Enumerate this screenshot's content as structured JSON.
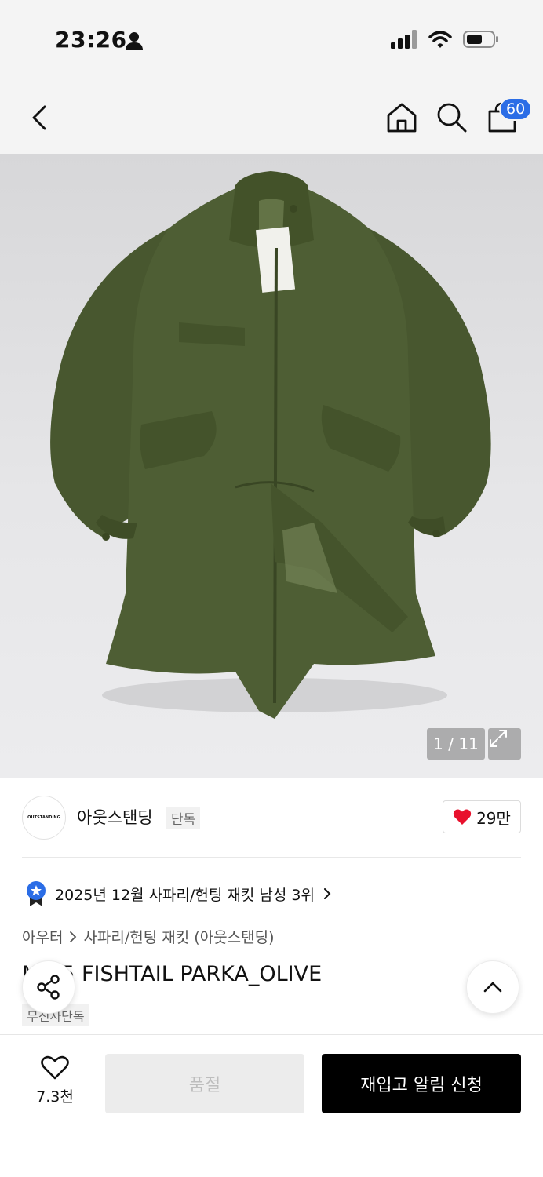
{
  "status_bar": {
    "time": "23:26"
  },
  "nav": {
    "cart_count": "60"
  },
  "gallery": {
    "counter": "1 / 11"
  },
  "brand": {
    "logo_text": "OUTSTANDING",
    "name": "아웃스탠딩",
    "tag": "단독",
    "likes": "29만"
  },
  "ranking": {
    "text": "2025년 12월 사파리/헌팅 재킷 남성 3위"
  },
  "breadcrumb": {
    "category": "아우터",
    "subcategory": "사파리/헌팅 재킷 (아웃스탠딩)"
  },
  "product": {
    "title": "M-65 FISHTAIL PARKA_OLIVE",
    "exclusive_tag": "무신사단독"
  },
  "bottom": {
    "wish_count": "7.3천",
    "soldout_label": "품절",
    "restock_label": "재입고 알림 신청"
  },
  "colors": {
    "accent": "#2b6de6",
    "heart": "#e8112d",
    "jacket": "#4b5a35"
  }
}
